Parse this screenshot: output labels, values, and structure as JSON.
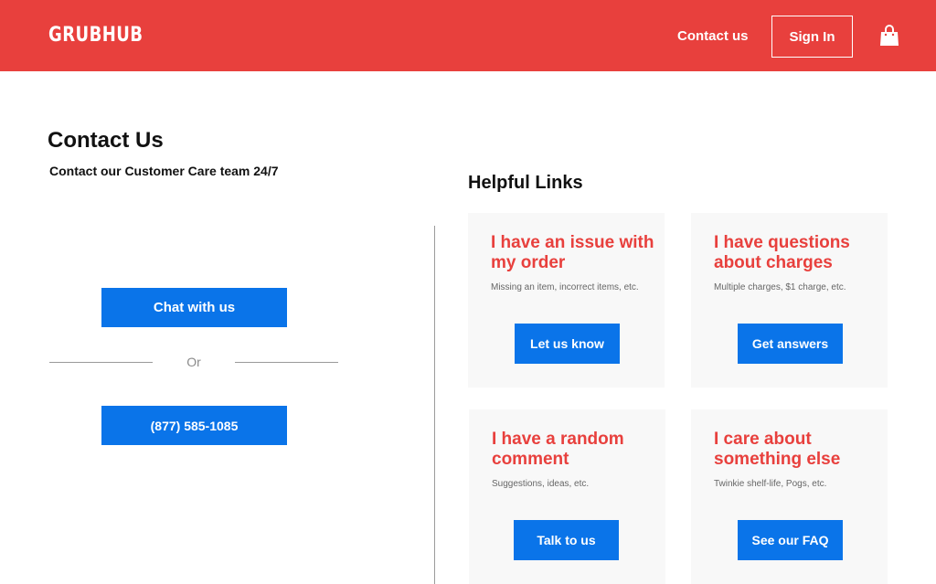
{
  "header": {
    "logo": "GRUBHUB",
    "contact_link": "Contact us",
    "signin_label": "Sign In",
    "cart_icon": "shopping-bag-icon",
    "bg_color": "#e8403d"
  },
  "contact": {
    "title": "Contact Us",
    "subtitle": "Contact our Customer Care team 24/7",
    "chat_label": "Chat with us",
    "or_label": "Or",
    "phone_label": "(877) 585-1085"
  },
  "helpful": {
    "title": "Helpful Links",
    "cards": [
      {
        "heading": "I have an issue with my order",
        "desc": "Missing an item, incorrect items, etc.",
        "button": "Let us know"
      },
      {
        "heading": "I have questions about charges",
        "desc": "Multiple charges, $1 charge, etc.",
        "button": "Get answers"
      },
      {
        "heading": "I have a random comment",
        "desc": "Suggestions, ideas, etc.",
        "button": "Talk to us"
      },
      {
        "heading": "I care about something else",
        "desc": "Twinkie shelf-life, Pogs, etc.",
        "button": "See our FAQ"
      }
    ]
  },
  "colors": {
    "accent_red": "#e8403d",
    "button_blue": "#0a74e9"
  }
}
